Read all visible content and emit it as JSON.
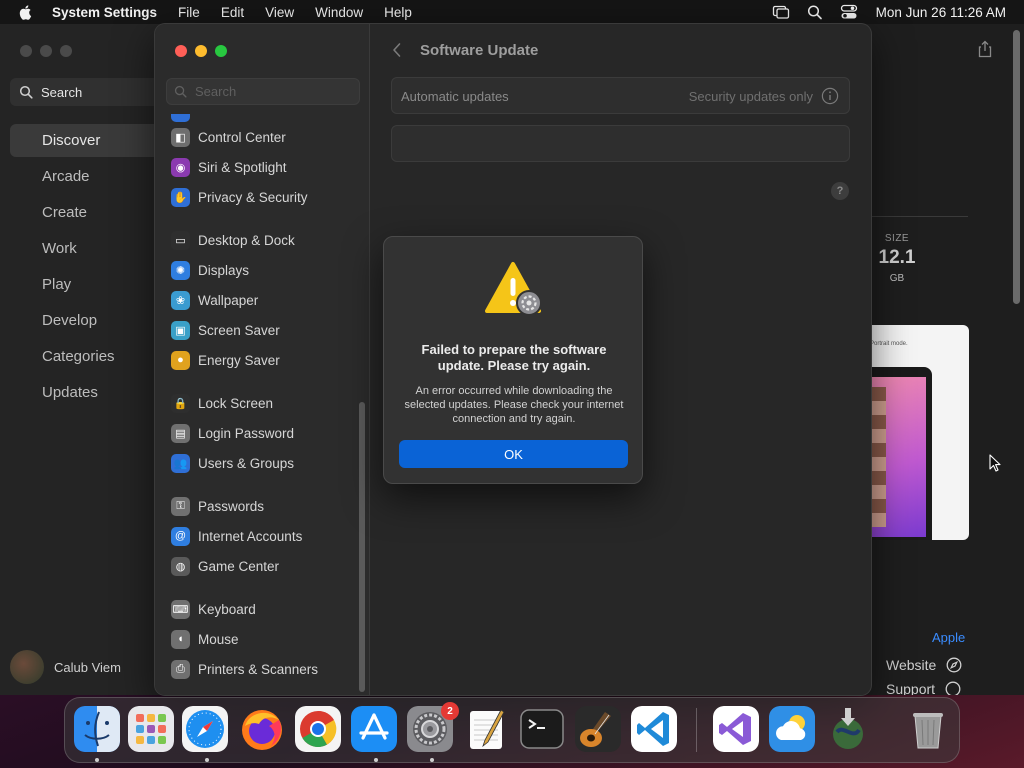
{
  "menubar": {
    "app_name": "System Settings",
    "menus": [
      "File",
      "Edit",
      "View",
      "Window",
      "Help"
    ],
    "clock": "Mon Jun 26  11:26 AM"
  },
  "appstore": {
    "search_label": "Search",
    "nav": [
      "Discover",
      "Arcade",
      "Create",
      "Work",
      "Play",
      "Develop",
      "Categories",
      "Updates"
    ],
    "user_name": "Calub Viem",
    "size_label": "SIZE",
    "size_value": "12.1",
    "size_unit": "GB",
    "screenshot_caption": "Portrait mode.",
    "developer_link": "Apple",
    "website_label": "Website",
    "support_label": "Support"
  },
  "settings": {
    "search_placeholder": "Search",
    "sidebar_groups": [
      [
        {
          "label": "Control Center",
          "icon": "control-center-icon",
          "color": "#6e6e6e",
          "glyph": "◧"
        },
        {
          "label": "Siri & Spotlight",
          "icon": "siri-icon",
          "color": "#8b3ab0",
          "glyph": "◉"
        },
        {
          "label": "Privacy & Security",
          "icon": "hand-icon",
          "color": "#2f6fd6",
          "glyph": "✋"
        }
      ],
      [
        {
          "label": "Desktop & Dock",
          "icon": "dock-icon",
          "color": "#2e2e2e",
          "glyph": "▭"
        },
        {
          "label": "Displays",
          "icon": "sun-icon",
          "color": "#2f7ee0",
          "glyph": "✺"
        },
        {
          "label": "Wallpaper",
          "icon": "wallpaper-icon",
          "color": "#3a9bd0",
          "glyph": "❀"
        },
        {
          "label": "Screen Saver",
          "icon": "screen-saver-icon",
          "color": "#3aa0c8",
          "glyph": "▣"
        },
        {
          "label": "Energy Saver",
          "icon": "bulb-icon",
          "color": "#e0a21e",
          "glyph": "●"
        }
      ],
      [
        {
          "label": "Lock Screen",
          "icon": "lock-icon",
          "color": "#2e2e2e",
          "glyph": "🔒"
        },
        {
          "label": "Login Password",
          "icon": "key-icon",
          "color": "#707070",
          "glyph": "▤"
        },
        {
          "label": "Users & Groups",
          "icon": "users-icon",
          "color": "#2f6fd6",
          "glyph": "👥"
        }
      ],
      [
        {
          "label": "Passwords",
          "icon": "passwords-key-icon",
          "color": "#707070",
          "glyph": "⚿"
        },
        {
          "label": "Internet Accounts",
          "icon": "at-icon",
          "color": "#2f7ee0",
          "glyph": "@"
        },
        {
          "label": "Game Center",
          "icon": "game-center-icon",
          "color": "#5a5a5a",
          "glyph": "◍"
        }
      ],
      [
        {
          "label": "Keyboard",
          "icon": "keyboard-icon",
          "color": "#707070",
          "glyph": "⌨"
        },
        {
          "label": "Mouse",
          "icon": "mouse-icon",
          "color": "#707070",
          "glyph": "◖"
        },
        {
          "label": "Printers & Scanners",
          "icon": "printer-icon",
          "color": "#707070",
          "glyph": "⎙"
        }
      ]
    ],
    "pane_title": "Software Update",
    "auto_updates_label": "Automatic updates",
    "auto_updates_value": "Security updates only"
  },
  "alert": {
    "title": "Failed to prepare the software update. Please try again.",
    "message": "An error occurred while downloading the selected updates. Please check your internet connection and try again.",
    "ok_label": "OK"
  },
  "dock": {
    "apps": [
      {
        "name": "finder-icon",
        "running": true
      },
      {
        "name": "launchpad-icon",
        "running": false
      },
      {
        "name": "safari-icon",
        "running": true
      },
      {
        "name": "firefox-icon",
        "running": false
      },
      {
        "name": "chrome-icon",
        "running": false
      },
      {
        "name": "app-store-icon",
        "running": true
      },
      {
        "name": "system-settings-icon",
        "running": true,
        "badge": "2"
      },
      {
        "name": "textedit-icon",
        "running": false
      },
      {
        "name": "terminal-icon",
        "running": false
      },
      {
        "name": "garageband-icon",
        "running": false
      },
      {
        "name": "vscode-icon",
        "running": false
      },
      {
        "name": "visual-studio-icon",
        "running": false
      },
      {
        "name": "weather-icon",
        "running": false
      },
      {
        "name": "downloads-icon",
        "running": false
      },
      {
        "name": "trash-icon",
        "running": false
      }
    ]
  },
  "colors": {
    "accent": "#0a63d6",
    "link": "#3a8cff",
    "traffic_red": "#ff5f57",
    "traffic_yellow": "#febc2e",
    "traffic_green": "#28c840",
    "badge": "#e53935"
  }
}
